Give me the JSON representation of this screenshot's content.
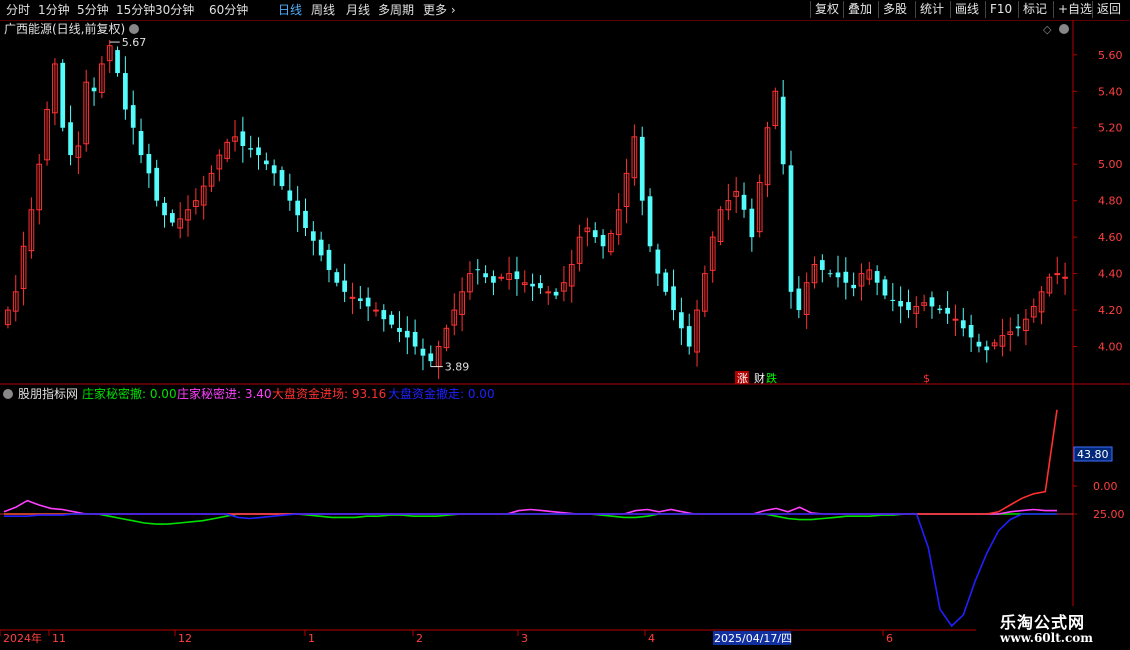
{
  "toolbar": {
    "periods": [
      "分时",
      "1分钟",
      "5分钟",
      "15分钟",
      "30分钟",
      "60分钟",
      "日线",
      "周线",
      "月线",
      "多周期",
      "更多"
    ],
    "active_period": "日线",
    "right_buttons": [
      "复权",
      "叠加",
      "多股",
      "统计",
      "画线",
      "F10",
      "标记",
      "+自选",
      "返回"
    ]
  },
  "main_panel": {
    "title": "广西能源(日线,前复权)",
    "high_label": "5.67",
    "low_label": "3.89",
    "event_markers": [
      "涨",
      "财",
      "跌",
      "$"
    ]
  },
  "indicator_panel": {
    "name": "股朋指标网",
    "items": [
      {
        "label": "庄家秘密撤: 0.00",
        "color": "#00e000"
      },
      {
        "label": "庄家秘密进: 3.40",
        "color": "#ff40ff"
      },
      {
        "label": "大盘资金进场: 93.16",
        "color": "#ff3030"
      },
      {
        "label": "大盘资金撤走: 0.00",
        "color": "#2020ff"
      }
    ],
    "last_value_label": "43.80",
    "axis_labels": [
      "25.00",
      "0.00"
    ]
  },
  "date_axis": {
    "labels": [
      "2024年",
      "11",
      "12",
      "1",
      "2",
      "3",
      "4",
      "2025/04/17/四",
      "6"
    ]
  },
  "watermark": {
    "line1": "乐淘公式网",
    "line2": "www.60lt.com"
  },
  "colors": {
    "up": "#ff3232",
    "down": "#54fcfc",
    "axis": "#b40000",
    "grid": "#5a0000"
  },
  "chart_data": [
    {
      "type": "candlestick",
      "title": "广西能源(日线,前复权)",
      "y_ticks": [
        4.0,
        4.2,
        4.4,
        4.6,
        4.8,
        5.0,
        5.2,
        5.4,
        5.6
      ],
      "ylim": [
        3.8,
        5.78
      ],
      "high": 5.67,
      "low": 3.89,
      "close_path": [
        4.2,
        4.3,
        4.55,
        4.75,
        5.0,
        5.3,
        5.55,
        5.2,
        5.05,
        5.1,
        5.45,
        5.4,
        5.55,
        5.65,
        5.5,
        5.3,
        5.2,
        5.05,
        4.95,
        4.8,
        4.72,
        4.68,
        4.7,
        4.75,
        4.8,
        4.88,
        4.95,
        5.05,
        5.12,
        5.15,
        5.1,
        5.08,
        5.05,
        5.0,
        4.95,
        4.88,
        4.8,
        4.72,
        4.65,
        4.58,
        4.5,
        4.42,
        4.35,
        4.3,
        4.27,
        4.25,
        4.22,
        4.2,
        4.15,
        4.12,
        4.08,
        4.05,
        4.0,
        3.95,
        3.92,
        4.0,
        4.1,
        4.2,
        4.3,
        4.4,
        4.42,
        4.38,
        4.35,
        4.38,
        4.4,
        4.37,
        4.35,
        4.33,
        4.32,
        4.3,
        4.28,
        4.35,
        4.45,
        4.6,
        4.65,
        4.6,
        4.55,
        4.62,
        4.75,
        4.95,
        5.15,
        4.8,
        4.55,
        4.4,
        4.3,
        4.2,
        4.1,
        4.0,
        4.2,
        4.4,
        4.6,
        4.75,
        4.8,
        4.85,
        4.75,
        4.6,
        4.9,
        5.2,
        5.4,
        5.0,
        4.3,
        4.2,
        4.35,
        4.45,
        4.42,
        4.4,
        4.38,
        4.35,
        4.32,
        4.4,
        4.42,
        4.35,
        4.28,
        4.25,
        4.22,
        4.2,
        4.22,
        4.24,
        4.22,
        4.2,
        4.18,
        4.15,
        4.1,
        4.05,
        4.0,
        3.98,
        4.02,
        4.06,
        4.08,
        4.1,
        4.15,
        4.22,
        4.3,
        4.38,
        4.4,
        4.38
      ]
    },
    {
      "type": "line",
      "name": "股朋指标网",
      "y_ticks": [
        0,
        25
      ],
      "last_value": 43.8,
      "series": [
        {
          "name": "庄家秘密撤",
          "last": 0.0,
          "color": "#00e000",
          "values": [
            0,
            0,
            0,
            0,
            0,
            0,
            0,
            0,
            0,
            -2,
            -4,
            -6,
            -8,
            -9,
            -9,
            -8,
            -7,
            -6,
            -4,
            -2,
            0,
            0,
            0,
            0,
            0,
            0,
            -1,
            -2,
            -3,
            -3,
            -3,
            -2,
            -2,
            -1,
            -1,
            -2,
            -2,
            -2,
            -1,
            0,
            0,
            0,
            0,
            0,
            0,
            0,
            0,
            0,
            0,
            0,
            0,
            -1,
            -2,
            -3,
            -3,
            -2,
            0,
            0,
            0,
            0,
            0,
            0,
            0,
            0,
            0,
            0,
            -2,
            -4,
            -5,
            -5,
            -4,
            -3,
            -2,
            -2,
            -2,
            -1,
            -1,
            0,
            0,
            0,
            0,
            0,
            0,
            0,
            0,
            0,
            0,
            0,
            0,
            0,
            0
          ]
        },
        {
          "name": "庄家秘密进",
          "last": 3.4,
          "color": "#ff40ff",
          "values": [
            2,
            6,
            12,
            8,
            5,
            4,
            2,
            0,
            0,
            0,
            0,
            0,
            0,
            0,
            0,
            0,
            0,
            0,
            0,
            0,
            0,
            0,
            0,
            0,
            0,
            0,
            0,
            0,
            0,
            0,
            0,
            0,
            0,
            0,
            0,
            0,
            0,
            0,
            0,
            0,
            0,
            0,
            0,
            0,
            3,
            4,
            3,
            2,
            1,
            0,
            0,
            0,
            0,
            0,
            3,
            4,
            2,
            4,
            2,
            0,
            0,
            0,
            0,
            0,
            0,
            3,
            5,
            2,
            6,
            1,
            0,
            0,
            0,
            0,
            0,
            0,
            0,
            0,
            0,
            0,
            0,
            0,
            0,
            0,
            0,
            0,
            2,
            3,
            4,
            3,
            3
          ]
        },
        {
          "name": "大盘资金进场",
          "last": 93.16,
          "color": "#ff3030",
          "values": [
            0,
            0,
            0,
            0,
            0,
            0,
            0,
            0,
            0,
            0,
            0,
            0,
            0,
            0,
            0,
            0,
            0,
            0,
            0,
            0,
            0,
            0,
            0,
            0,
            0,
            0,
            0,
            0,
            0,
            0,
            0,
            0,
            0,
            0,
            0,
            0,
            0,
            0,
            0,
            0,
            0,
            0,
            0,
            0,
            0,
            0,
            0,
            0,
            0,
            0,
            0,
            0,
            0,
            0,
            0,
            0,
            0,
            0,
            0,
            0,
            0,
            0,
            0,
            0,
            0,
            0,
            0,
            0,
            0,
            0,
            0,
            0,
            0,
            0,
            0,
            0,
            0,
            0,
            0,
            0,
            0,
            0,
            0,
            0,
            0,
            2,
            8,
            14,
            18,
            20,
            93.16
          ]
        },
        {
          "name": "大盘资金撤走",
          "last": 0.0,
          "color": "#2020ff",
          "values": [
            -2,
            -2,
            -2,
            -1,
            -1,
            -1,
            0,
            0,
            0,
            0,
            0,
            0,
            0,
            0,
            0,
            0,
            0,
            0,
            0,
            0,
            -3,
            -4,
            -3,
            -2,
            -1,
            0,
            0,
            0,
            0,
            0,
            0,
            0,
            0,
            0,
            0,
            0,
            0,
            0,
            0,
            0,
            0,
            0,
            0,
            0,
            0,
            0,
            0,
            0,
            0,
            0,
            0,
            0,
            0,
            0,
            0,
            0,
            0,
            0,
            0,
            0,
            0,
            0,
            0,
            0,
            0,
            0,
            0,
            0,
            0,
            0,
            0,
            0,
            0,
            0,
            0,
            0,
            0,
            0,
            0,
            -30,
            -85,
            -100,
            -90,
            -60,
            -35,
            -15,
            -5,
            0,
            0,
            0,
            0
          ]
        }
      ]
    }
  ]
}
